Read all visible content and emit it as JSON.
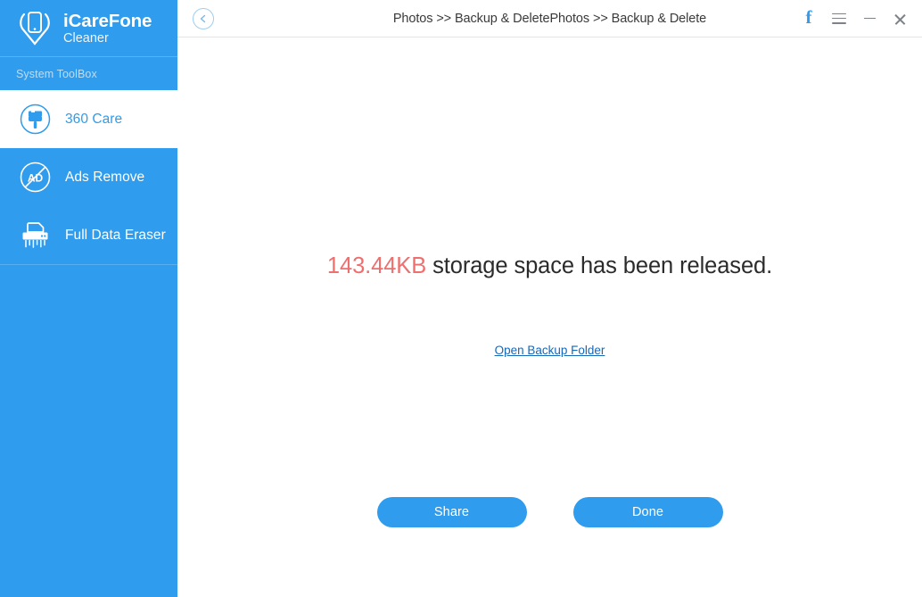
{
  "brand": {
    "logo_icon": "phone-pin-logo-icon",
    "title": "iCareFone",
    "subtitle": "Cleaner"
  },
  "sidebar": {
    "section_label": "System ToolBox",
    "items": [
      {
        "label": "360 Care",
        "icon": "paintbrush-circle-icon",
        "active": true
      },
      {
        "label": "Ads Remove",
        "icon": "ad-blocked-circle-icon",
        "active": false
      },
      {
        "label": "Full Data Eraser",
        "icon": "paper-shredder-icon",
        "active": false
      }
    ]
  },
  "titlebar": {
    "back_icon": "back-chevron-circle-icon",
    "breadcrumb": "Photos >> Backup & DeletePhotos >> Backup & Delete",
    "facebook_icon": "facebook-icon",
    "menu_icon": "hamburger-menu-icon",
    "minimize_icon": "minimize-icon",
    "close_icon": "close-icon"
  },
  "main": {
    "result_size": "143.44KB",
    "result_text": " storage space has been released.",
    "backup_link": "Open Backup Folder",
    "share_label": "Share",
    "done_label": "Done"
  },
  "colors": {
    "brand_blue": "#2f9ced",
    "result_red": "#ef6e6e",
    "link_blue": "#1668b8"
  }
}
